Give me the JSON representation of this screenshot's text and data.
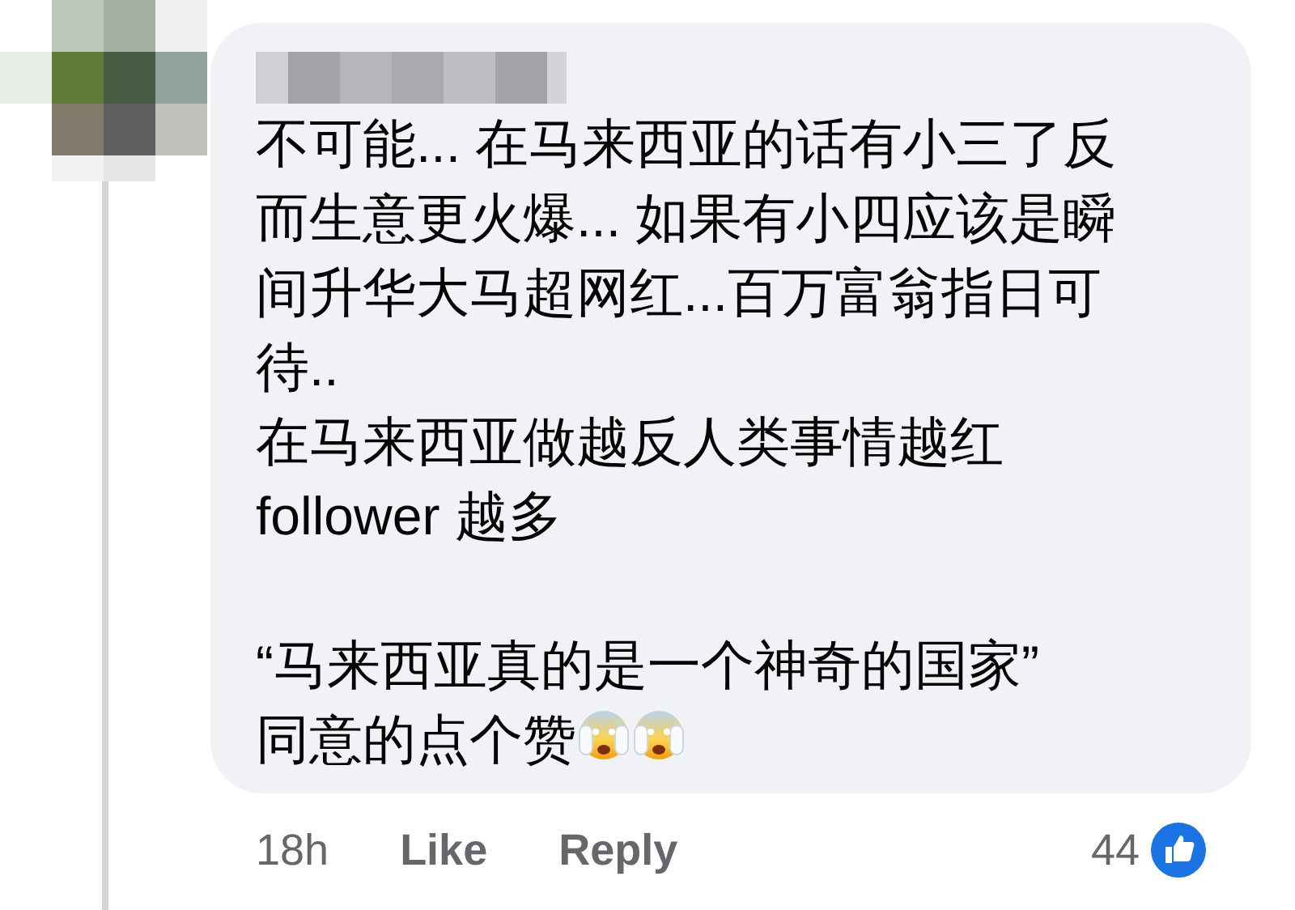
{
  "comment": {
    "paragraphs": [
      {
        "lines": [
          "不可能... 在马来西亚的话有小三了反",
          "而生意更火爆... 如果有小四应该是瞬",
          "间升华大马超网红...百万富翁指日可",
          "待.."
        ]
      },
      {
        "lines": [
          "在马来西亚做越反人类事情越红",
          "follower 越多"
        ]
      },
      {
        "lines": [
          "“马来西亚真的是一个神奇的国家”",
          "同意的点个赞"
        ]
      }
    ]
  },
  "footer": {
    "time": "18h",
    "actions": [
      "Like",
      "Reply"
    ],
    "reaction_count": "44"
  }
}
